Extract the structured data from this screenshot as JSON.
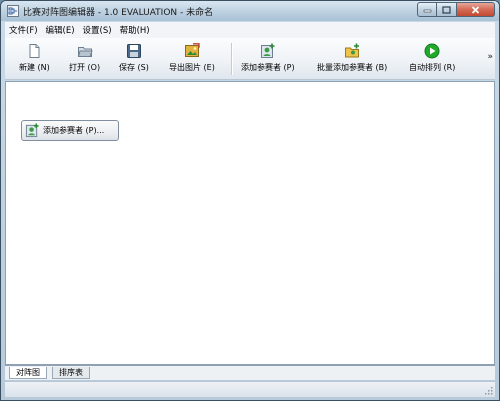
{
  "window": {
    "title": "比赛对阵图编辑器 - 1.0 EVALUATION - 未命名"
  },
  "menu": [
    {
      "label": "文件(F)"
    },
    {
      "label": "编辑(E)"
    },
    {
      "label": "设置(S)"
    },
    {
      "label": "帮助(H)"
    }
  ],
  "toolbar": {
    "new_label": "新建 (N)",
    "open_label": "打开 (O)",
    "save_label": "保存 (S)",
    "export_label": "导出图片 (E)",
    "add_label": "添加参赛者 (P)",
    "batch_add_label": "批量添加参赛者 (B)",
    "auto_arrange_label": "自动排列 (R)",
    "overflow_glyph": "»"
  },
  "canvas": {
    "add_button_label": "添加参赛者 (P)..."
  },
  "tabs": [
    {
      "label": "对阵图",
      "active": true
    },
    {
      "label": "排序表",
      "active": false
    }
  ],
  "colors": {
    "titlebar": "#bcd0e0",
    "close_button": "#c24a32",
    "auto_arrange_green": "#1faa2a"
  }
}
